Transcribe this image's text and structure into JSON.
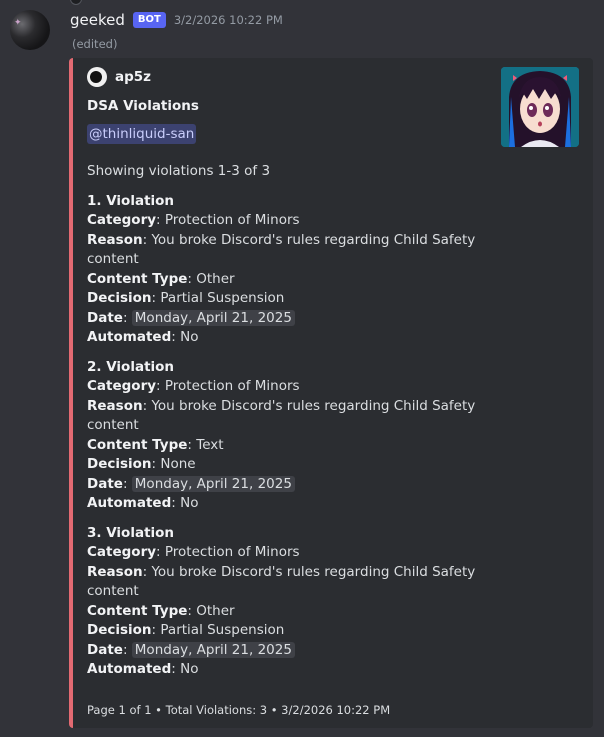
{
  "message": {
    "username": "geeked",
    "bot_tag": "BOT",
    "timestamp": "3/2/2026 10:22 PM",
    "edited": "(edited)"
  },
  "embed": {
    "accent_color": "#e36a72",
    "author": "ap5z",
    "title": "DSA Violations",
    "mention": "@thinliquid-san",
    "showing": "Showing violations 1-3 of 3",
    "labels": {
      "category": "Category",
      "reason": "Reason",
      "content_type": "Content Type",
      "decision": "Decision",
      "date": "Date",
      "automated": "Automated"
    },
    "violations": [
      {
        "heading": "1. Violation",
        "category": "Protection of Minors",
        "reason_1": "You broke Discord's rules regarding Child Safety",
        "reason_2": "content",
        "content_type": "Other",
        "decision": "Partial Suspension",
        "date": "Monday, April 21, 2025",
        "automated": "No"
      },
      {
        "heading": "2. Violation",
        "category": "Protection of Minors",
        "reason_1": "You broke Discord's rules regarding Child Safety",
        "reason_2": "content",
        "content_type": "Text",
        "decision": "None",
        "date": "Monday, April 21, 2025",
        "automated": "No"
      },
      {
        "heading": "3. Violation",
        "category": "Protection of Minors",
        "reason_1": "You broke Discord's rules regarding Child Safety",
        "reason_2": "content",
        "content_type": "Other",
        "decision": "Partial Suspension",
        "date": "Monday, April 21, 2025",
        "automated": "No"
      }
    ],
    "footer": "Page 1 of 1 • Total Violations: 3 • 3/2/2026 10:22 PM"
  }
}
